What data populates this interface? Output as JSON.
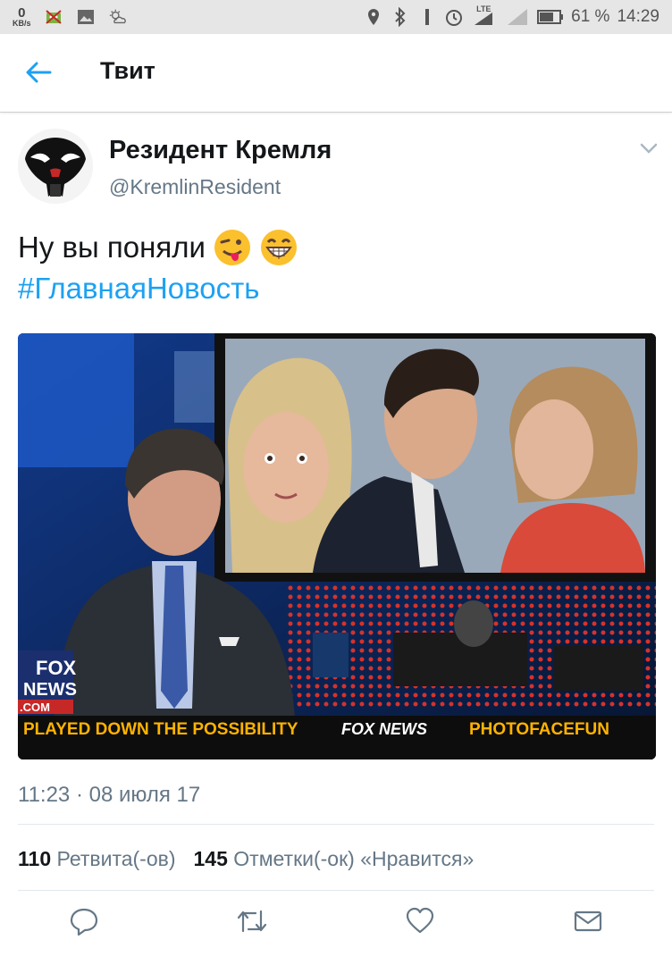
{
  "status_bar": {
    "net_speed": "0",
    "net_unit": "KB/s",
    "network": "LTE",
    "battery": "61 %",
    "time": "14:29"
  },
  "app_bar": {
    "title": "Твит",
    "back_icon": "arrow-left-icon"
  },
  "tweet": {
    "author_name": "Резидент Кремля",
    "author_handle": "@KremlinResident",
    "text": "Ну вы поняли",
    "emojis": [
      "winking-tongue-emoji",
      "grinning-emoji"
    ],
    "hashtag": "#ГлавнаяНовость",
    "media": {
      "description_icon": "tv-news-photo",
      "ticker_text": "PLAYED DOWN THE POSSIBILITY",
      "ticker_brand": "FOX NEWS",
      "ticker_credit": "PHOTOFACEFUN",
      "logo_top": "FOX",
      "logo_bottom": "NEWS",
      "logo_com": ".COM"
    },
    "timestamp": "11:23 · 08 июля 17",
    "retweets_count": "110",
    "retweets_label": "Ретвита(-ов)",
    "likes_count": "145",
    "likes_label": "Отметки(-ок) «Нравится»"
  },
  "actions": [
    "reply-icon",
    "retweet-icon",
    "like-icon",
    "direct-message-icon"
  ],
  "colors": {
    "accent": "#1da1f2",
    "secondary_text": "#657786",
    "primary_text": "#14171a"
  }
}
